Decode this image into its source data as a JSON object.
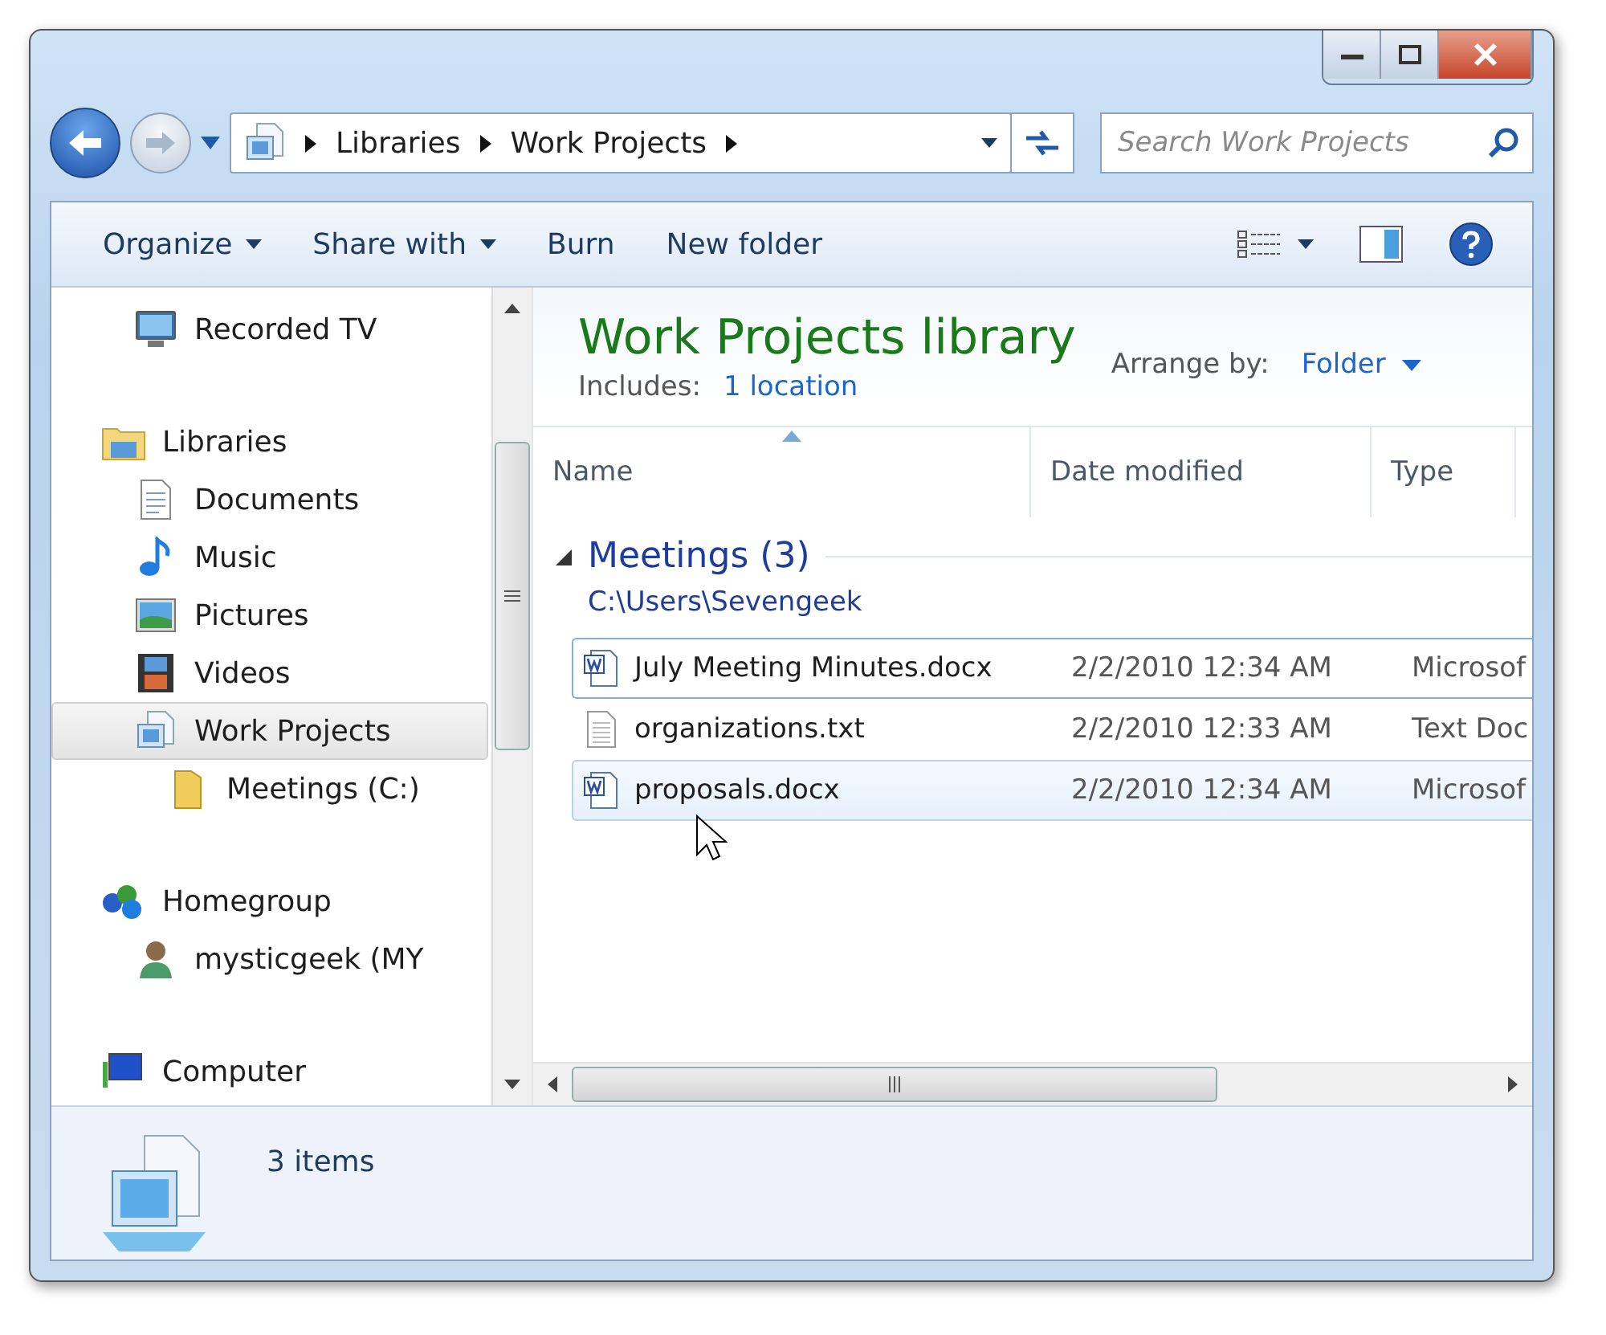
{
  "address_bar": {
    "segments": [
      "Libraries",
      "Work Projects"
    ]
  },
  "search": {
    "placeholder": "Search Work Projects"
  },
  "toolbar": {
    "items": [
      {
        "label": "Organize",
        "dropdown": true
      },
      {
        "label": "Share with",
        "dropdown": true
      },
      {
        "label": "Burn",
        "dropdown": false
      },
      {
        "label": "New folder",
        "dropdown": false
      }
    ]
  },
  "nav_pane": {
    "groups": [
      {
        "children": [
          {
            "label": "Recorded TV",
            "kind": "tv",
            "selected": false
          }
        ]
      },
      {
        "label": "Libraries",
        "kind": "libraries",
        "selected": false,
        "children": [
          {
            "label": "Documents",
            "kind": "documents",
            "selected": false
          },
          {
            "label": "Music",
            "kind": "music",
            "selected": false
          },
          {
            "label": "Pictures",
            "kind": "pictures",
            "selected": false
          },
          {
            "label": "Videos",
            "kind": "videos",
            "selected": false
          },
          {
            "label": "Work Projects",
            "kind": "library",
            "selected": true,
            "children": [
              {
                "label": "Meetings (C:)",
                "kind": "folder",
                "selected": false
              }
            ]
          }
        ]
      },
      {
        "label": "Homegroup",
        "kind": "homegroup",
        "selected": false,
        "children": [
          {
            "label": "mysticgeek (MY",
            "kind": "user",
            "selected": false
          }
        ]
      },
      {
        "label": "Computer",
        "kind": "computer",
        "selected": false
      }
    ]
  },
  "library_header": {
    "title": "Work Projects library",
    "includes_label": "Includes:",
    "includes_link": "1 location",
    "arrange_label": "Arrange by:",
    "arrange_value": "Folder"
  },
  "columns": [
    {
      "label": "Name",
      "sorted": true
    },
    {
      "label": "Date modified",
      "sorted": false
    },
    {
      "label": "Type",
      "sorted": false
    }
  ],
  "group": {
    "title": "Meetings (3)",
    "expanded": true,
    "path": "C:\\Users\\Sevengeek",
    "rows": [
      {
        "name": "July Meeting Minutes.docx",
        "date": "2/2/2010 12:34 AM",
        "type": "Microsof",
        "kind": "word",
        "selected": true,
        "hovered": false
      },
      {
        "name": "organizations.txt",
        "date": "2/2/2010 12:33 AM",
        "type": "Text Doc",
        "kind": "text",
        "selected": false,
        "hovered": false
      },
      {
        "name": "proposals.docx",
        "date": "2/2/2010 12:34 AM",
        "type": "Microsof",
        "kind": "word",
        "selected": false,
        "hovered": true
      }
    ]
  },
  "status_bar": {
    "count": "3 items"
  }
}
